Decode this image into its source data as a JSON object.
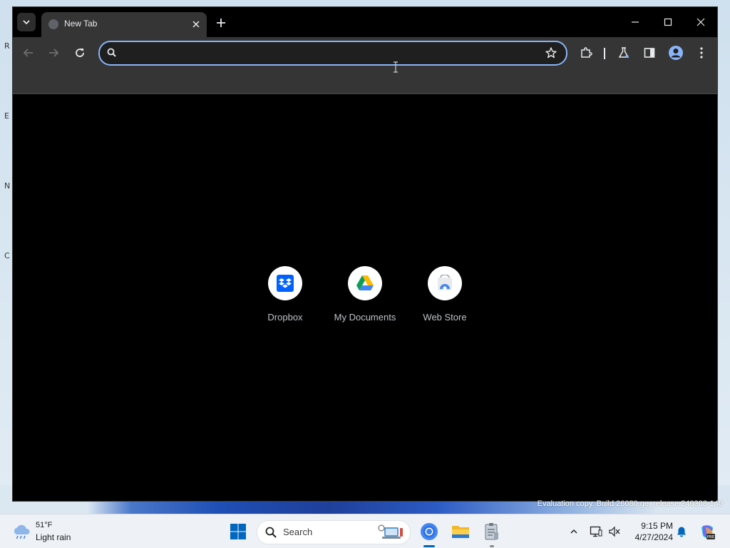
{
  "browser": {
    "tab": {
      "title": "New Tab"
    },
    "omnibox": {
      "value": "",
      "placeholder": ""
    },
    "shortcuts": [
      {
        "label": "Dropbox",
        "icon": "dropbox-icon"
      },
      {
        "label": "My Documents",
        "icon": "google-drive-icon"
      },
      {
        "label": "Web Store",
        "icon": "web-store-icon"
      }
    ]
  },
  "desktop": {
    "watermark": "Evaluation copy. Build 26080.ge_release.240308-140"
  },
  "taskbar": {
    "weather": {
      "temp": "51°F",
      "desc": "Light rain"
    },
    "search_label": "Search",
    "clock": {
      "time": "9:15 PM",
      "date": "4/27/2024"
    }
  },
  "colors": {
    "accent": "#8ab4f8",
    "tab_strip": "#000000",
    "toolbar": "#353535",
    "taskbar": "#eef2f7",
    "windows_blue": "#0067c0"
  }
}
